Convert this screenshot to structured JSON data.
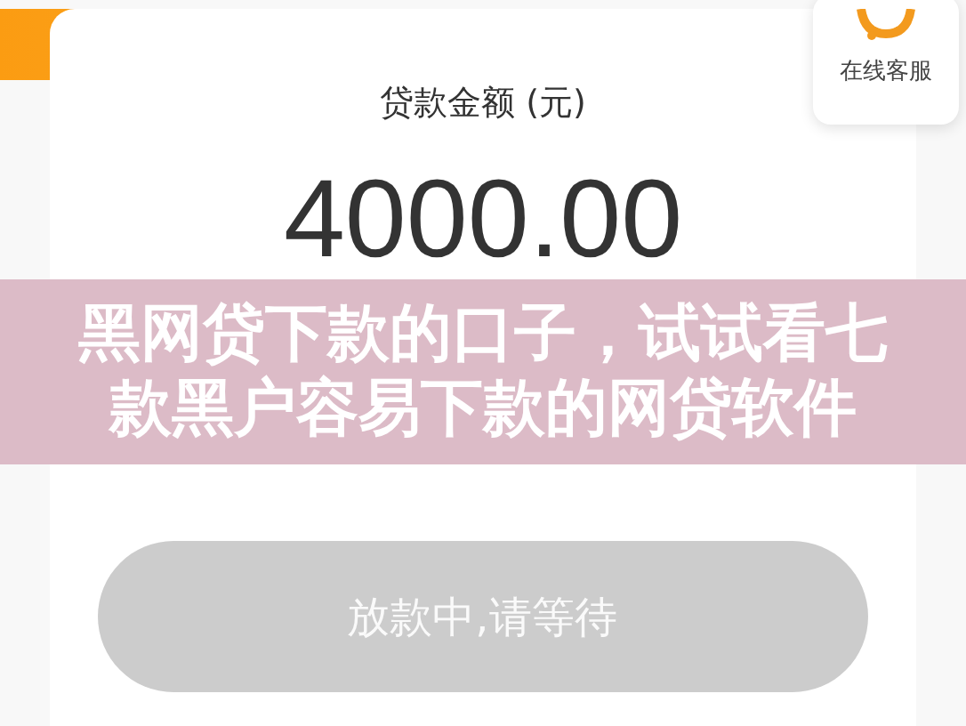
{
  "loan": {
    "label": "贷款金额 (元)",
    "amount": "4000.00"
  },
  "service": {
    "label": "在线客服"
  },
  "action_button": {
    "label": "放款中,请等待",
    "disabled": true
  },
  "caption_banner": {
    "lines": [
      "黑网贷下款的口子，试试看七",
      "款黑户容易下款的网贷软件"
    ]
  }
}
